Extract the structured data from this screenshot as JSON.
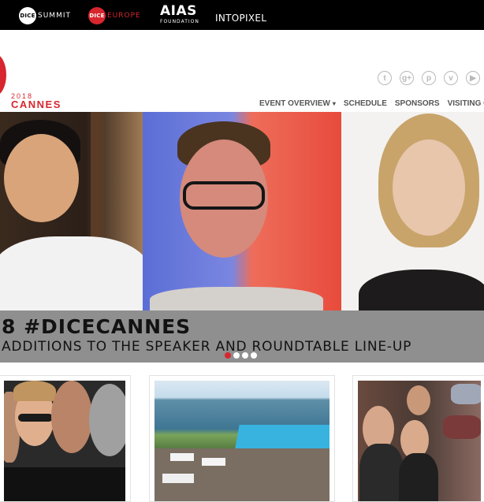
{
  "topbar": {
    "dice_summit": {
      "badge": "DICE",
      "word": "SUMMIT"
    },
    "dice_europe": {
      "badge": "DICE",
      "word": "EUROPE"
    },
    "aias": {
      "title": "AIAS",
      "subtitle": "FOUNDATION"
    },
    "intopixel": "INTOPIXEL"
  },
  "logo": {
    "year": "2018",
    "city": "CANNES"
  },
  "social_icons": [
    {
      "name": "twitch-icon",
      "glyph": "t"
    },
    {
      "name": "google-plus-icon",
      "glyph": "g+"
    },
    {
      "name": "pinterest-icon",
      "glyph": "p"
    },
    {
      "name": "vine-icon",
      "glyph": "v"
    },
    {
      "name": "youtube-icon",
      "glyph": "▶"
    }
  ],
  "nav": {
    "event_overview": "EVENT OVERVIEW",
    "schedule": "SCHEDULE",
    "sponsors": "SPONSORS",
    "visiting": "VISITING CAN"
  },
  "hero": {
    "title": "8 #DICECANNES",
    "subtitle": "ADDITIONS TO THE SPEAKER AND ROUNDTABLE LINE-UP",
    "slide_count": 4,
    "active_slide": 1
  },
  "colors": {
    "brand_red": "#d7262e",
    "nav_text": "#555555",
    "topbar": "#000000"
  }
}
